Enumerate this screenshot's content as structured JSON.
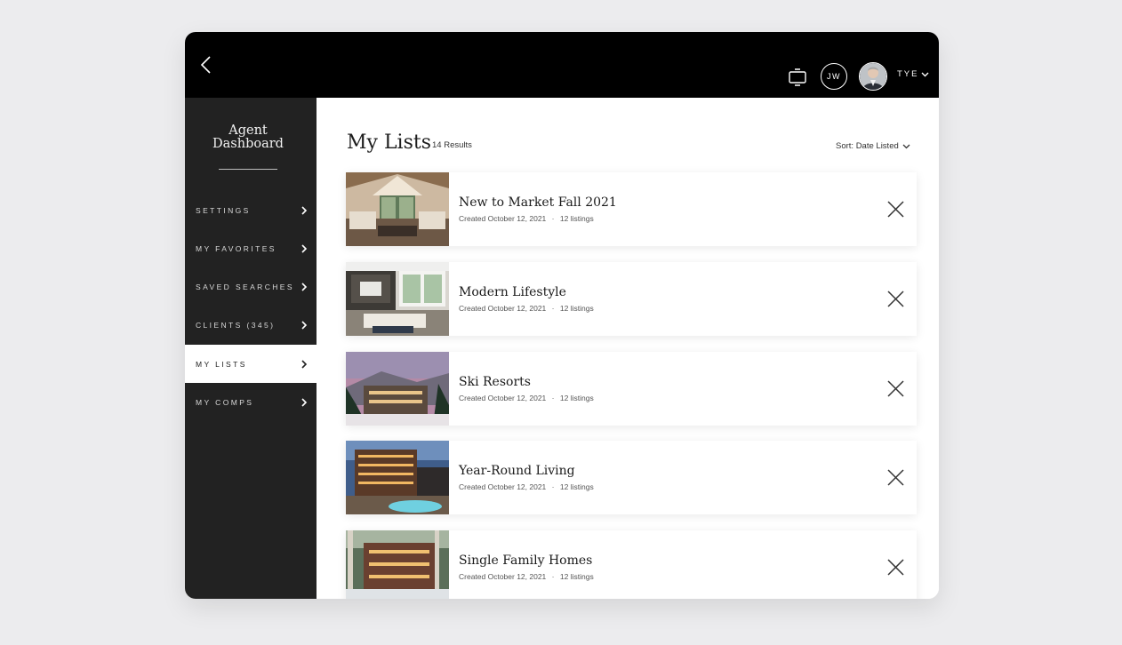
{
  "header": {
    "user_initials": "JW",
    "user_name": "TYE",
    "icons": [
      "back-arrow-icon",
      "cast-icon",
      "chevron-down-icon"
    ]
  },
  "sidebar": {
    "brand_line1": "Agent",
    "brand_line2": "Dashboard",
    "items": [
      {
        "label": "SETTINGS"
      },
      {
        "label": "MY FAVORITES"
      },
      {
        "label": "SAVED SEARCHES"
      },
      {
        "label": "CLIENTS (345)"
      },
      {
        "label": "MY LISTS",
        "active": true
      },
      {
        "label": "MY COMPS"
      }
    ]
  },
  "main": {
    "title": "My Lists",
    "results": "14 Results",
    "sort_label": "Sort: Date Listed",
    "lists": [
      {
        "title": "New to Market Fall 2021",
        "created": "Created October 12, 2021",
        "count": "12 listings",
        "image": "living-room-photo"
      },
      {
        "title": "Modern Lifestyle",
        "created": "Created October 12, 2021",
        "count": "12 listings",
        "image": "media-room-photo"
      },
      {
        "title": "Ski Resorts",
        "created": "Created October 12, 2021",
        "count": "12 listings",
        "image": "ski-lodge-photo"
      },
      {
        "title": "Year-Round Living",
        "created": "Created October 12, 2021",
        "count": "12 listings",
        "image": "resort-pool-photo"
      },
      {
        "title": "Single Family Homes",
        "created": "Created October 12, 2021",
        "count": "12 listings",
        "image": "mountain-home-photo"
      }
    ],
    "separator": "·"
  },
  "colors": {
    "page_bg": "#ececee",
    "topbar": "#000000",
    "sidebar": "#222222",
    "active_nav": "#ffffff"
  }
}
